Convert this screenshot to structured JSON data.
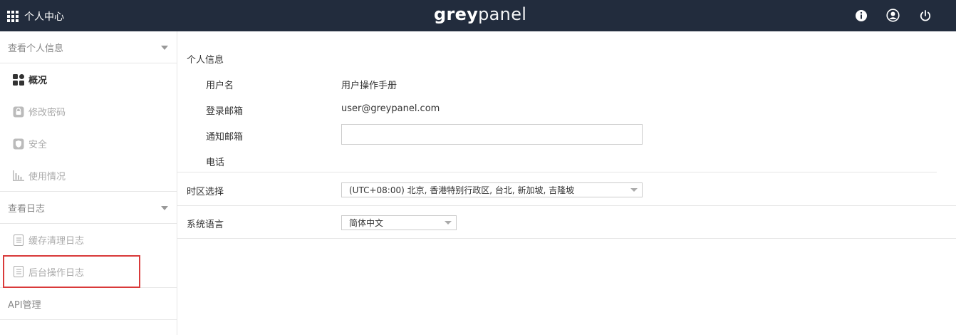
{
  "header": {
    "title": "个人中心",
    "logo_part1": "grey",
    "logo_part2": "panel",
    "icons": [
      "info-icon",
      "user-icon",
      "power-icon"
    ]
  },
  "sidebar": {
    "group_profile": "查看个人信息",
    "items_profile": [
      {
        "label": "概况",
        "icon": "dashboard-icon",
        "active": true
      },
      {
        "label": "修改密码",
        "icon": "lock-icon"
      },
      {
        "label": "安全",
        "icon": "shield-icon"
      },
      {
        "label": "使用情况",
        "icon": "bar-chart-icon"
      }
    ],
    "group_logs": "查看日志",
    "items_logs": [
      {
        "label": "缓存清理日志",
        "icon": "list-icon"
      },
      {
        "label": "后台操作日志",
        "icon": "list-icon"
      }
    ],
    "api": "API管理"
  },
  "main": {
    "personal_info_title": "个人信息",
    "username_label": "用户名",
    "username_value": "用户操作手册",
    "login_email_label": "登录邮箱",
    "login_email_value": "user@greypanel.com",
    "notify_email_label": "通知邮箱",
    "notify_email_value": "",
    "phone_label": "电话",
    "timezone_label": "时区选择",
    "timezone_value": "(UTC+08:00) 北京, 香港特别行政区, 台北, 新加坡, 吉隆坡",
    "language_label": "系统语言",
    "language_value": "简体中文"
  },
  "colors": {
    "topbar": "#222c3d",
    "highlight": "#d93a3a"
  }
}
